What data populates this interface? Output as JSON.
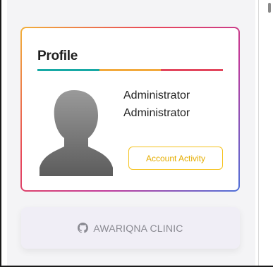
{
  "profile": {
    "title": "Profile",
    "first_name": "Administrator",
    "last_name": "Administrator",
    "activity_button_label": "Account Activity",
    "avatar_icon": "user-silhouette-icon"
  },
  "clinic": {
    "label": "AWARIQNA CLINIC",
    "icon": "github-icon"
  },
  "colors": {
    "accent_teal": "#17a9a5",
    "accent_orange": "#f2a93b",
    "accent_red": "#e2455c",
    "activity_button": "#f5c21b"
  }
}
